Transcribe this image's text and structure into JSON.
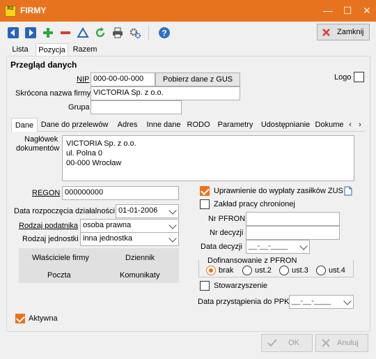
{
  "window": {
    "title": "FIRMY",
    "logo": "R2"
  },
  "toolbar": {
    "close_label": "Zamknij"
  },
  "tabs_main": [
    "Lista",
    "Pozycja",
    "Razem"
  ],
  "section_title": "Przegląd danych",
  "nip": {
    "label": "NIP",
    "value": "000-00-00-000",
    "button": "Pobierz dane z GUS"
  },
  "logo_label": "Logo",
  "short_name": {
    "label": "Skrócona nazwa firmy",
    "value": "VICTORIA Sp. z o.o."
  },
  "group": {
    "label": "Grupa",
    "value": ""
  },
  "tabs_detail": [
    "Dane",
    "Dane do przelewów",
    "Adres",
    "Inne dane",
    "RODO",
    "Parametry",
    "Udostępnianie",
    "Dokume"
  ],
  "headers": {
    "label_line1": "Nagłówek",
    "label_line2": "dokumentów",
    "lines": [
      "VICTORIA Sp. z o.o.",
      "ul. Polna 0",
      "00-000 Wrocław"
    ]
  },
  "regon": {
    "label": "REGON",
    "value": "000000000"
  },
  "start_date": {
    "label": "Data rozpoczęcia działalności",
    "value": "01-01-2006"
  },
  "taxpayer_type": {
    "label": "Rodzaj podatnika",
    "value": "osoba prawna"
  },
  "unit_type": {
    "label": "Rodzaj jednostki",
    "value": "inna jednostka"
  },
  "grid_buttons": {
    "owners": "Właściciele firmy",
    "diary": "Dziennik",
    "mail": "Poczta",
    "messages": "Komunikaty"
  },
  "zus": {
    "label": "Uprawnienie do wypłaty zasiłków ZUS",
    "checked": true
  },
  "protected": {
    "label": "Zakład pracy chronionej",
    "checked": false
  },
  "pfron_nr": {
    "label": "Nr PFRON",
    "value": ""
  },
  "decision_nr": {
    "label": "Nr decyzji",
    "value": ""
  },
  "decision_date": {
    "label": "Data decyzji",
    "value": "__-__-____"
  },
  "pfron_funding": {
    "label": "Dofinansowanie z PFRON",
    "options": [
      "brak",
      "ust.2",
      "ust.3",
      "ust.4"
    ],
    "selected": "brak"
  },
  "association": {
    "label": "Stowarzyszenie",
    "checked": false
  },
  "ppk_date": {
    "label": "Data przystąpienia do PPK",
    "value": "__-__-____"
  },
  "active": {
    "label": "Aktywna",
    "checked": true
  },
  "footer": {
    "ok": "OK",
    "cancel": "Anuluj"
  },
  "colors": {
    "accent": "#e8731e",
    "toolbar_blue": "#2a64b8",
    "toolbar_green": "#2ba640",
    "toolbar_red": "#d93a3a",
    "help_blue": "#2f6fc4"
  }
}
